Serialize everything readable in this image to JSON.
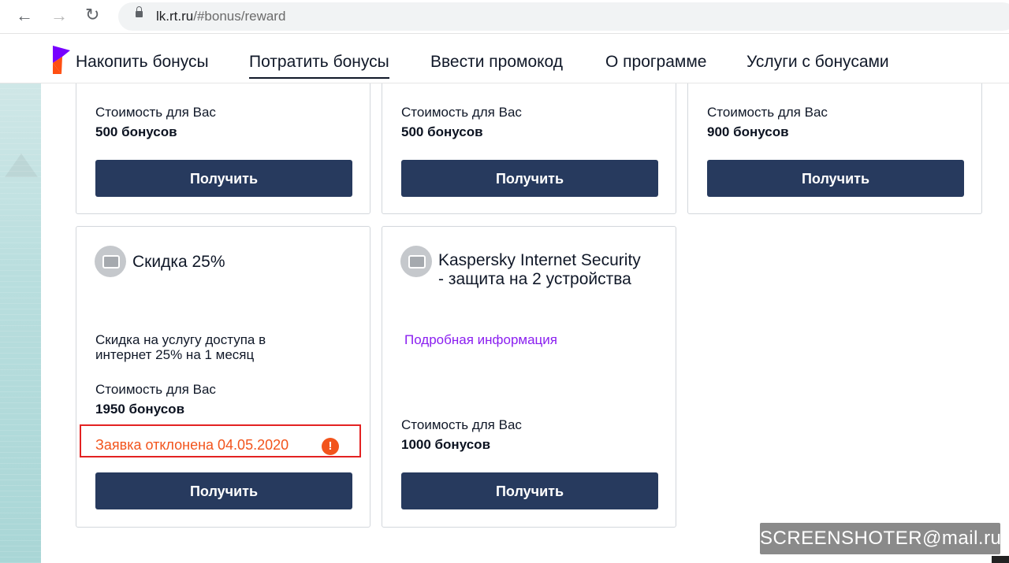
{
  "browser": {
    "url_host": "lk.rt.ru",
    "url_path": "/#bonus/reward"
  },
  "nav": {
    "items": [
      {
        "label": "Накопить бонусы"
      },
      {
        "label": "Потратить бонусы",
        "active": true
      },
      {
        "label": "Ввести промокод"
      },
      {
        "label": "О программе"
      },
      {
        "label": "Услуги с бонусами"
      }
    ]
  },
  "cards_top": [
    {
      "cost_label": "Стоимость для Вас",
      "cost_value": "500 бонусов",
      "button": "Получить"
    },
    {
      "cost_label": "Стоимость для Вас",
      "cost_value": "500 бонусов",
      "button": "Получить"
    },
    {
      "cost_label": "Стоимость для Вас",
      "cost_value": "900 бонусов",
      "button": "Получить"
    }
  ],
  "cards_bottom": [
    {
      "title": "Скидка 25%",
      "desc_line1": "Скидка на услугу доступа в",
      "desc_line2": "интернет 25% на 1 месяц",
      "cost_label": "Стоимость для Вас",
      "cost_value": "1950 бонусов",
      "status": "Заявка отклонена 04.05.2020",
      "status_icon": "!",
      "button": "Получить"
    },
    {
      "title_line1": "Kaspersky Internet Security",
      "title_line2": "- защита на 2 устройства",
      "more_link": "Подробная информация",
      "cost_label": "Стоимость для Вас",
      "cost_value": "1000 бонусов",
      "button": "Получить"
    }
  ],
  "watermark": "SCREENSHOTER@mail.ru",
  "colors": {
    "button": "#273a5e",
    "link": "#8a1ef0",
    "status": "#f2541c",
    "status_border": "#e32222",
    "brand_orange": "#ff4f12",
    "brand_purple": "#7700ff"
  }
}
